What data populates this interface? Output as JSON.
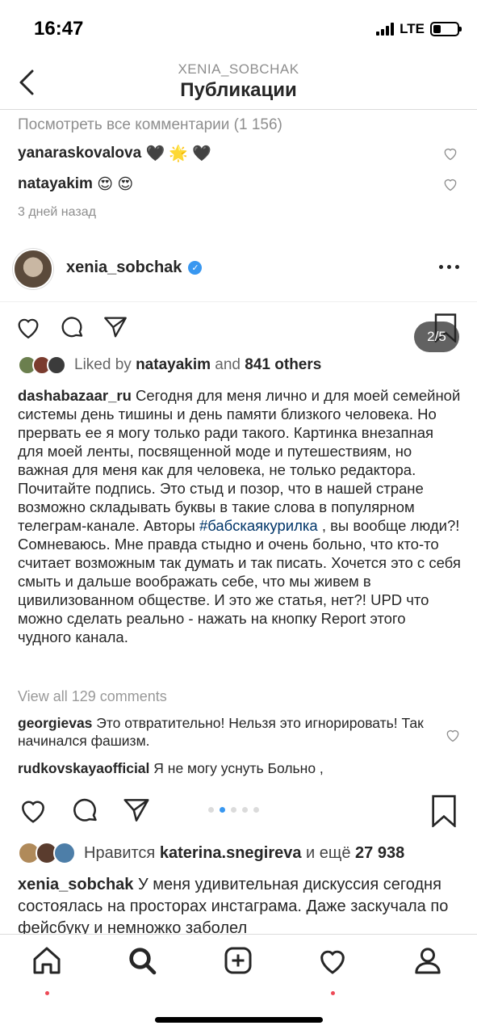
{
  "status": {
    "time": "16:47",
    "network": "LTE",
    "battery_level": 0.25
  },
  "nav": {
    "subtitle": "XENIA_SOBCHAK",
    "title": "Публикации"
  },
  "prev_post": {
    "view_all": "Посмотреть все комментарии (1 156)",
    "comments": [
      {
        "user": "yanaraskovalova",
        "text": "🖤 🌟 🖤"
      },
      {
        "user": "natayakim",
        "text": "😍 😍"
      }
    ],
    "ago": "3 дней назад"
  },
  "post": {
    "username": "xenia_sobchak",
    "inner": {
      "counter": "2/5",
      "likes_prefix": "Liked by",
      "likes_user": "natayakim",
      "likes_and": "and",
      "likes_others": "841 others",
      "caption_user": "dashabazaar_ru",
      "caption_text_1": "Сегодня для меня лично и для моей семейной системы день тишины и день памяти близкого человека. Но прервать ее я могу только ради такого. Картинка внезапная для моей ленты, посвященной моде и путешествиям, но важная для меня как для человека, не только редактора. Почитайте подпись. Это стыд и позор, что в нашей стране возможно складывать буквы в такие слова в популярном телеграм-канале. Авторы ",
      "caption_tag": "#бабскаякурилка",
      "caption_text_2": ", вы вообще люди?! Сомневаюсь. Мне правда стыдно и очень больно, что кто-то считает возможным так думать и так писать. Хочется это с себя смыть и дальше воображать себе, что мы живем в цивилизованном обществе. И это же статья, нет?! UPD что можно сделать реально - нажать на кнопку Report этого чудного канала.",
      "view_all": "View all 129 comments",
      "comments": [
        {
          "user": "georgievas",
          "text": "Это отвратительно! Нельзя это игнорировать! Так начинался фашизм."
        },
        {
          "user": "rudkovskayaofficial",
          "text": "Я не могу уснуть Больно ,"
        }
      ]
    },
    "pager": {
      "count": 5,
      "active": 2
    },
    "likes_prefix": "Нравится",
    "likes_user": "katerina.snegireva",
    "likes_and": "и ещё",
    "likes_count": "27 938",
    "caption_user": "xenia_sobchak",
    "caption_text": "У меня удивительная дискуссия сегодня состоялась на просторах инстаграма. Даже заскучала по фейсбуку и немножко заболел"
  },
  "colors": {
    "accent": "#3897f0",
    "text": "#262626",
    "muted": "#8e8e8e",
    "hashtag": "#003569",
    "notification": "#ed4956"
  },
  "tabs": [
    {
      "icon": "home-icon",
      "dot": true
    },
    {
      "icon": "search-icon",
      "dot": false
    },
    {
      "icon": "add-post-icon",
      "dot": false
    },
    {
      "icon": "activity-heart-icon",
      "dot": true
    },
    {
      "icon": "profile-icon",
      "dot": false
    }
  ]
}
